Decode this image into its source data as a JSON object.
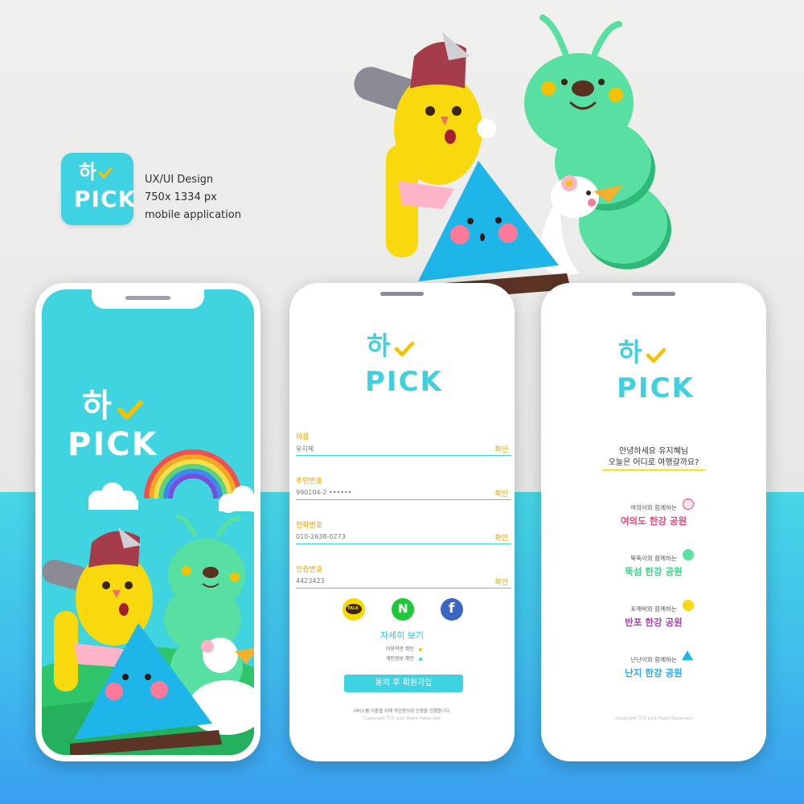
{
  "header": {
    "app_icon": {
      "ha": "하",
      "pick": "PICK"
    },
    "design_info": [
      "UX/UI Design",
      "750x 1334 px",
      "mobile application"
    ]
  },
  "logo": {
    "ha": "하",
    "pick": "PICK"
  },
  "colors": {
    "brand_cyan": "#40d0df",
    "accent_yellow": "#f5c200",
    "pink": "#e8457a",
    "green": "#3bcf8a",
    "purple": "#a53fa8",
    "sky": "#2aa8e6"
  },
  "signup": {
    "fields": [
      {
        "label": "이름",
        "value": "유지혜",
        "confirm": "확인"
      },
      {
        "label": "주민번호",
        "value": "990104-2 ••••••",
        "confirm": "확인"
      },
      {
        "label": "전화번호",
        "value": "010-2638-0273",
        "confirm": "확인"
      },
      {
        "label": "인증번호",
        "value": "4423423",
        "confirm": "확인"
      }
    ],
    "social": [
      {
        "icon": "kakao-talk-icon",
        "text": "TALK"
      },
      {
        "icon": "naver-icon",
        "text": "N"
      },
      {
        "icon": "facebook-icon",
        "text": "f"
      }
    ],
    "more_label": "자세히 보기",
    "agreements": [
      "이용약관 확인",
      "개인정보 확인"
    ],
    "submit_label": "동의 후 회원가입",
    "footer_note": "서비스를 이용을 위해 약관동의와 인증을 진행합니다.",
    "copyright": "Copyright 한강 pick Right Reserved"
  },
  "destinations": {
    "greeting": [
      "안녕하세요 유지혜님",
      "오늘은 어디로 여행갈까요?"
    ],
    "items": [
      {
        "sub": "여의이와 함께하는",
        "name": "여의도 한강 공원",
        "color": "#e8457a"
      },
      {
        "sub": "뚝뚝이와 함께하는",
        "name": "뚝섬 한강 공원",
        "color": "#3bcf8a"
      },
      {
        "sub": "포깨비와 함께하는",
        "name": "반포 한강 공원",
        "color": "#a53fa8"
      },
      {
        "sub": "난난이와 함께하는",
        "name": "난지 한강 공원",
        "color": "#2aa8e6"
      }
    ],
    "copyright": "Copyright 한강 pick Right Reserved"
  }
}
